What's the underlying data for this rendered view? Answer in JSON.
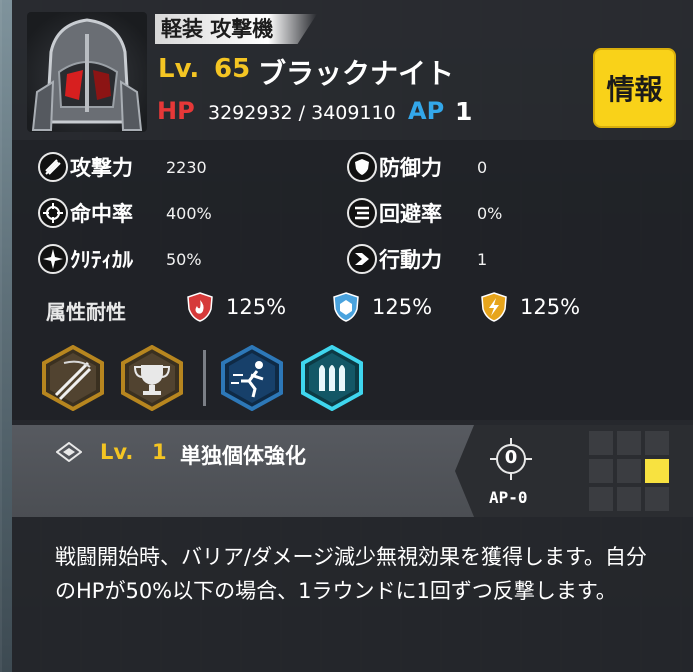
{
  "unit": {
    "class": "軽装 攻撃機",
    "level_label": "Lv.",
    "level": "65",
    "name": "ブラックナイト",
    "hp_label": "HP",
    "hp": "3292932 / 3409110",
    "ap_label": "AP",
    "ap": "1"
  },
  "info_button": "情報",
  "stats": [
    {
      "label": "攻撃力",
      "value": "2230",
      "icon": "attack-icon"
    },
    {
      "label": "防御力",
      "value": "0",
      "icon": "defense-icon"
    },
    {
      "label": "命中率",
      "value": "400%",
      "icon": "accuracy-icon"
    },
    {
      "label": "回避率",
      "value": "0%",
      "icon": "evasion-icon"
    },
    {
      "label": "ｸﾘﾃｨｶﾙ",
      "value": "50%",
      "icon": "critical-icon"
    },
    {
      "label": "行動力",
      "value": "1",
      "icon": "mobility-icon"
    }
  ],
  "resistances": {
    "label": "属性耐性",
    "items": [
      {
        "type": "fire",
        "value": "125%",
        "color": "#d63a3a"
      },
      {
        "type": "ice",
        "value": "125%",
        "color": "#4aa3de"
      },
      {
        "type": "electric",
        "value": "125%",
        "color": "#e7a51c"
      }
    ]
  },
  "skills": [
    {
      "icon": "slash-skill-icon",
      "color": "#b7861f"
    },
    {
      "icon": "trophy-skill-icon",
      "color": "#b7861f"
    },
    {
      "icon": "sprint-skill-icon",
      "color": "#2d78b8"
    },
    {
      "icon": "ammo-skill-icon",
      "color": "#3fd6ee"
    }
  ],
  "selected_skill": {
    "level_label": "Lv.",
    "level": "1",
    "name": "単独個体強化",
    "target_value": "0",
    "ap_cost": "AP-0",
    "description": "戦闘開始時、バリア/ダメージ減少無視効果を獲得します。自分のHPが50%以下の場合、1ラウンドに1回ずつ反撃します。"
  }
}
